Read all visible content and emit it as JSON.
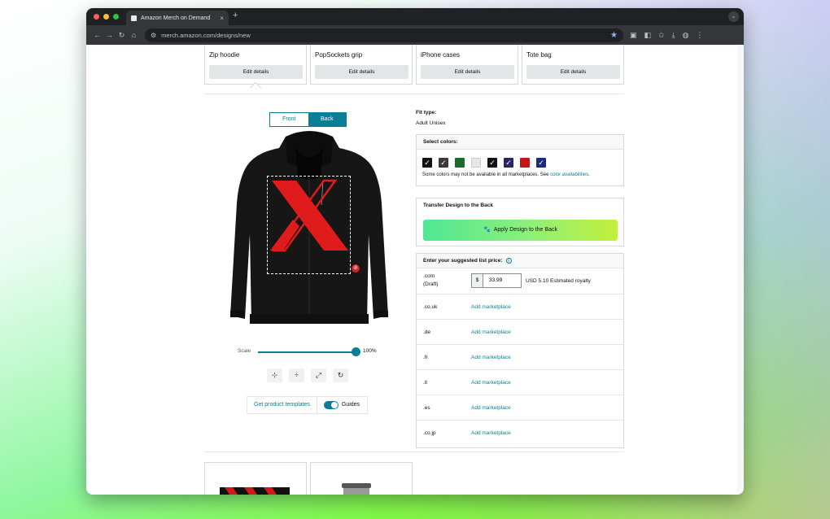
{
  "browser": {
    "tab_title": "Amazon Merch on Demand",
    "tab_close": "×",
    "new_tab": "+",
    "url": "merch.amazon.com/designs/new"
  },
  "products": [
    {
      "name": "Zip hoodie",
      "button": "Edit details"
    },
    {
      "name": "PopSockets grip",
      "button": "Edit details"
    },
    {
      "name": "iPhone cases",
      "button": "Edit details"
    },
    {
      "name": "Tote bag",
      "button": "Edit details"
    }
  ],
  "editor": {
    "side_tabs": [
      "Front",
      "Back"
    ],
    "active_side": "Back",
    "scale_label": "Scale",
    "scale_value": "100%",
    "scale_fraction": 1.0,
    "get_templates": "Get product templates",
    "guides_label": "Guides",
    "guides_on": true
  },
  "fit": {
    "label": "Fit type:",
    "value": "Adult Unisex"
  },
  "colors": {
    "title": "Select colors:",
    "swatches": [
      "#111111",
      "#3a3a3a",
      "#1b6b2f",
      "#e6e6e6",
      "#111111",
      "#2b2466",
      "#c51616",
      "#1c2b7a"
    ],
    "note": "Some colors may not be available in all marketplaces. See",
    "note_link": "color availabilities",
    "note_end": "."
  },
  "transfer": {
    "title": "Transfer Design to the Back",
    "button": "Apply Design to the Back"
  },
  "pricing": {
    "title": "Enter your suggested list price:",
    "first": {
      "code": ".com",
      "sub": "(Draft)",
      "currency": "$",
      "price": "33.99",
      "royalty": "USD 5.10  Estimated royalty"
    },
    "marketplaces": [
      {
        "code": ".co.uk",
        "action": "Add marketplace"
      },
      {
        "code": ".de",
        "action": "Add marketplace"
      },
      {
        "code": ".fr",
        "action": "Add marketplace"
      },
      {
        "code": ".it",
        "action": "Add marketplace"
      },
      {
        "code": ".es",
        "action": "Add marketplace"
      },
      {
        "code": ".co.jp",
        "action": "Add marketplace"
      }
    ]
  },
  "accent_color": "#0a7e96"
}
